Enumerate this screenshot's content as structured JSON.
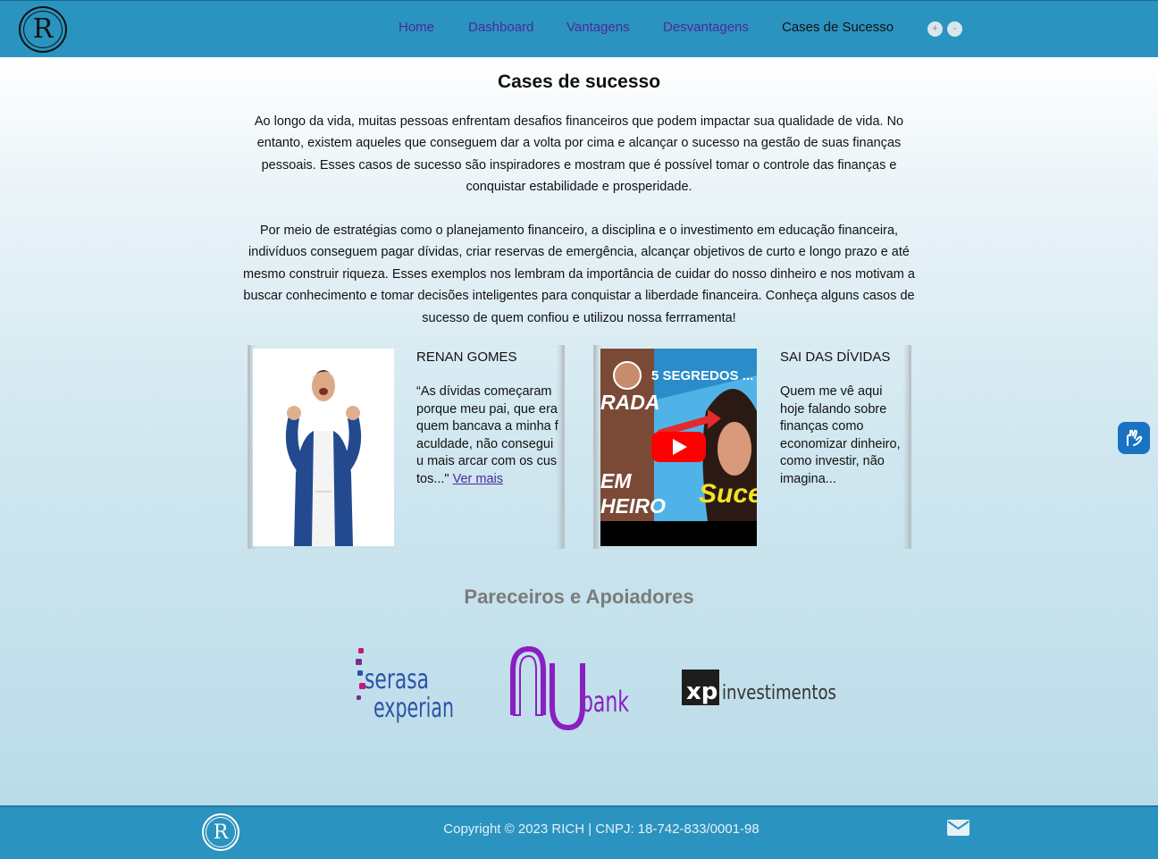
{
  "header": {
    "logo_letter": "R",
    "nav": [
      "Home",
      "Dashboard",
      "Vantagens",
      "Desvantagens",
      "Cases de Sucesso"
    ],
    "font_increase": "+",
    "font_decrease": "-"
  },
  "main": {
    "title": "Cases de sucesso",
    "paragraph1": "Ao longo da vida, muitas pessoas enfrentam desafios financeiros que podem impactar sua qualidade de vida. No entanto, existem aqueles que conseguem dar a volta por cima e alcançar o sucesso na gestão de suas finanças pessoais. Esses casos de sucesso são inspiradores e mostram que é possível tomar o controle das finanças e conquistar estabilidade e prosperidade.",
    "paragraph2": "Por meio de estratégias como o planejamento financeiro, a disciplina e o investimento em educação financeira, indivíduos conseguem pagar dívidas, criar reservas de emergência, alcançar objetivos de curto e longo prazo e até mesmo construir riqueza. Esses exemplos nos lembram da importância de cuidar do nosso dinheiro e nos motivam a buscar conhecimento e tomar decisões inteligentes para conquistar a liberdade financeira. Conheça alguns casos de sucesso de quem confiou e utilizou nossa ferrramenta!"
  },
  "cards": [
    {
      "title": "RENAN GOMES",
      "text": "“As dívidas começaram porque meu pai, que era quem bancava a minha faculdade, não conseguiu mais arcar com os custos...\"",
      "link": "Ver mais"
    },
    {
      "title": "SAI DAS DÍVIDAS",
      "text": "Quem me vê aqui hoje falando sobre finanças como economizar dinheiro, como investir, não imagina...",
      "video_title": "5 SEGREDOS ...",
      "video_caption_1": "RADA",
      "video_caption_2": "EM",
      "video_caption_3": "HEIRO",
      "video_caption_4": "Suce"
    }
  ],
  "partners": {
    "title": "Pareceiros e Apoiadores",
    "serasa_line1": "serasa",
    "serasa_line2": "experian",
    "nubank": "bank",
    "xp_mark": "xp",
    "xp_text": "investimentos"
  },
  "footer": {
    "logo_letter": "R",
    "copyright": "Copyright © 2023 RICH | CNPJ: 18-742-833/0001-98"
  },
  "colors": {
    "header": "#2b93bf",
    "nav_link": "#4a2b97",
    "nubank": "#8a1fc1",
    "accessibility_button": "#1a73c2"
  }
}
